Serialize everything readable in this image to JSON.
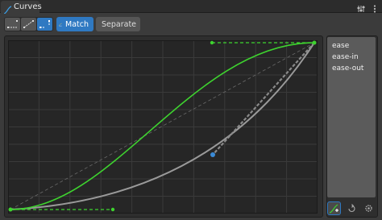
{
  "header": {
    "tab_label": "Curves",
    "icons": [
      "curve-icon",
      "sliders-icon",
      "menu-dots-icon"
    ]
  },
  "toolbar": {
    "tangent_buttons": [
      {
        "name": "linear-tangent",
        "active": false
      },
      {
        "name": "auto-tangent",
        "active": false
      },
      {
        "name": "broken-tangent",
        "active": true
      }
    ],
    "match_label": "Match",
    "separate_label": "Separate"
  },
  "presets": {
    "items": [
      "ease",
      "ease-in",
      "ease-out"
    ]
  },
  "side_buttons": [
    "add-preset",
    "refresh",
    "settings"
  ],
  "colors": {
    "accent": "#2f79c2",
    "curve_green": "#3ed32f",
    "curve_gray": "#9a9a9a",
    "handle_blue": "#3a8ad6",
    "grid": "#3a3a3a",
    "plot_bg": "#262626"
  }
}
